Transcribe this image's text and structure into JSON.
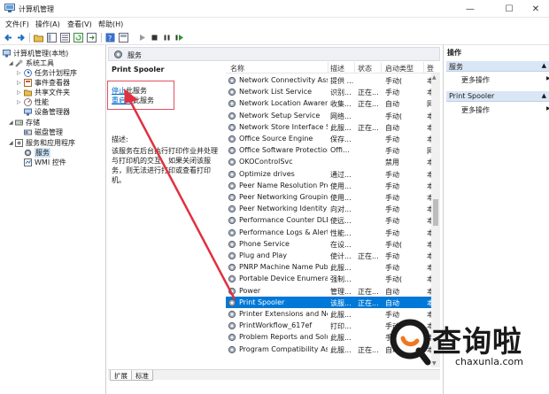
{
  "window": {
    "title": "计算机管理",
    "controls": {
      "minimize": "—",
      "maximize": "☐",
      "close": "✕"
    }
  },
  "menu": [
    "文件(F)",
    "操作(A)",
    "查看(V)",
    "帮助(H)"
  ],
  "tree": {
    "root": "计算机管理(本地)",
    "system_tools": "系统工具",
    "task_scheduler": "任务计划程序",
    "event_viewer": "事件查看器",
    "shared_folders": "共享文件夹",
    "performance": "性能",
    "device_manager": "设备管理器",
    "storage": "存储",
    "disk_management": "磁盘管理",
    "services_apps": "服务和应用程序",
    "services": "服务",
    "wmi": "WMI 控件"
  },
  "panel": {
    "header": "服务",
    "selected_service": "Print Spooler",
    "stop_link": "停止",
    "stop_suffix": "此服务",
    "restart_link": "重启动",
    "restart_suffix": "此服务",
    "desc_label": "描述:",
    "desc_text": "该服务在后台执行打印作业并处理与打印机的交互。如果关闭该服务，则无法进行打印或查看打印机。",
    "tabs": {
      "extended": "扩展",
      "standard": "标准"
    }
  },
  "list": {
    "columns": {
      "name": "名称",
      "desc": "描述",
      "status": "状态",
      "startup": "启动类型",
      "logon": "登"
    },
    "rows": [
      {
        "name": "Network Connectivity Assis...",
        "desc": "提供 ...",
        "status": "",
        "startup": "手动(",
        "logon": "本"
      },
      {
        "name": "Network List Service",
        "desc": "识别...",
        "status": "正在...",
        "startup": "手动",
        "logon": "本"
      },
      {
        "name": "Network Location Awarene...",
        "desc": "收集...",
        "status": "正在...",
        "startup": "自动",
        "logon": "网"
      },
      {
        "name": "Network Setup Service",
        "desc": "网络...",
        "status": "",
        "startup": "手动(",
        "logon": "本"
      },
      {
        "name": "Network Store Interface Se...",
        "desc": "此服...",
        "status": "正在...",
        "startup": "自动",
        "logon": "本"
      },
      {
        "name": "Office  Source Engine",
        "desc": "保存...",
        "status": "",
        "startup": "手动",
        "logon": "本"
      },
      {
        "name": "Office Software Protection ...",
        "desc": "Offi...",
        "status": "",
        "startup": "手动",
        "logon": "网"
      },
      {
        "name": "OKOControlSvc",
        "desc": "",
        "status": "",
        "startup": "禁用",
        "logon": "本"
      },
      {
        "name": "Optimize drives",
        "desc": "通过...",
        "status": "",
        "startup": "手动",
        "logon": "本"
      },
      {
        "name": "Peer Name Resolution Pro...",
        "desc": "使用...",
        "status": "",
        "startup": "手动",
        "logon": "本"
      },
      {
        "name": "Peer Networking Grouping",
        "desc": "使用...",
        "status": "",
        "startup": "手动",
        "logon": "本"
      },
      {
        "name": "Peer Networking Identity ...",
        "desc": "向对...",
        "status": "",
        "startup": "手动",
        "logon": "本"
      },
      {
        "name": "Performance Counter DLL ...",
        "desc": "使远...",
        "status": "",
        "startup": "手动",
        "logon": "本"
      },
      {
        "name": "Performance Logs & Alerts",
        "desc": "性能...",
        "status": "",
        "startup": "手动",
        "logon": "本"
      },
      {
        "name": "Phone Service",
        "desc": "在设...",
        "status": "",
        "startup": "手动(",
        "logon": "本"
      },
      {
        "name": "Plug and Play",
        "desc": "使计...",
        "status": "正在...",
        "startup": "手动",
        "logon": "本"
      },
      {
        "name": "PNRP Machine Name Publi...",
        "desc": "此服...",
        "status": "",
        "startup": "手动",
        "logon": "本"
      },
      {
        "name": "Portable Device Enumerat...",
        "desc": "强制...",
        "status": "",
        "startup": "手动(",
        "logon": "本"
      },
      {
        "name": "Power",
        "desc": "管理...",
        "status": "正在...",
        "startup": "自动",
        "logon": "本"
      },
      {
        "name": "Print Spooler",
        "desc": "该服...",
        "status": "正在...",
        "startup": "自动",
        "logon": "本"
      },
      {
        "name": "Printer Extensions and No...",
        "desc": "此服...",
        "status": "",
        "startup": "手动",
        "logon": "本"
      },
      {
        "name": "PrintWorkflow_617ef",
        "desc": "打印...",
        "status": "",
        "startup": "手动",
        "logon": "本"
      },
      {
        "name": "Problem Reports and Soluti...",
        "desc": "此服...",
        "status": "",
        "startup": "手动",
        "logon": "本"
      },
      {
        "name": "Program Compatibility Assi...",
        "desc": "此服...",
        "status": "正在...",
        "startup": "自动",
        "logon": "本"
      }
    ],
    "selected_index": 19
  },
  "actions": {
    "title": "操作",
    "section1": "服务",
    "more1": "更多操作",
    "section2": "Print Spooler",
    "more2": "更多操作"
  },
  "watermark": {
    "brand": "查询啦",
    "domain": "chaxunla.com"
  },
  "colors": {
    "selection": "#0078d7",
    "tree_selection": "#cce4f7",
    "annotation": "#e03040",
    "link": "#0066cc"
  }
}
